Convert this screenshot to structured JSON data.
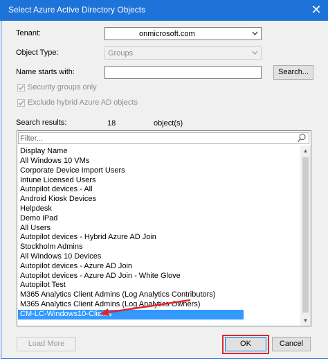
{
  "window": {
    "title": "Select Azure Active Directory Objects",
    "close_glyph": "✕"
  },
  "form": {
    "tenant_label": "Tenant:",
    "tenant_value": "onmicrosoft.com",
    "object_type_label": "Object Type:",
    "object_type_value": "Groups",
    "name_label": "Name starts with:",
    "name_value": "",
    "search_button": "Search...",
    "security_groups_label": "Security groups only",
    "exclude_hybrid_label": "Exclude hybrid Azure AD objects",
    "results_label": "Search results:",
    "results_count": "18",
    "results_unit": "object(s)"
  },
  "list": {
    "filter_placeholder": "Filter...",
    "header": "Display Name",
    "items": [
      "All Windows 10 VMs",
      "Corporate Device Import Users",
      "Intune Licensed Users",
      "Autopilot devices - All",
      "Android Kiosk Devices",
      "Helpdesk",
      "Demo iPad",
      "All Users",
      "Autopilot devices - Hybrid Azure AD Join",
      "Stockholm Admins",
      "All Windows 10 Devices",
      "Autopilot devices - Azure AD Join",
      "Autopilot devices - Azure AD Join - White Glove",
      "Autopilot Test",
      "M365 Analytics Client Admins (Log Analytics Contributors)",
      "M365 Analytics Client Admins (Log Analytics Owners)",
      "CM-LC-Windows10-Clients"
    ],
    "selected_index": 16
  },
  "footer": {
    "load_more": "Load More",
    "ok": "OK",
    "cancel": "Cancel"
  },
  "colors": {
    "titlebar": "#1e73d8",
    "selection": "#3399ff",
    "annotation": "#e0262b"
  },
  "icons": {
    "dropdown": "chevron-down-icon",
    "checkmark": "checkmark-icon",
    "search": "search-icon"
  }
}
